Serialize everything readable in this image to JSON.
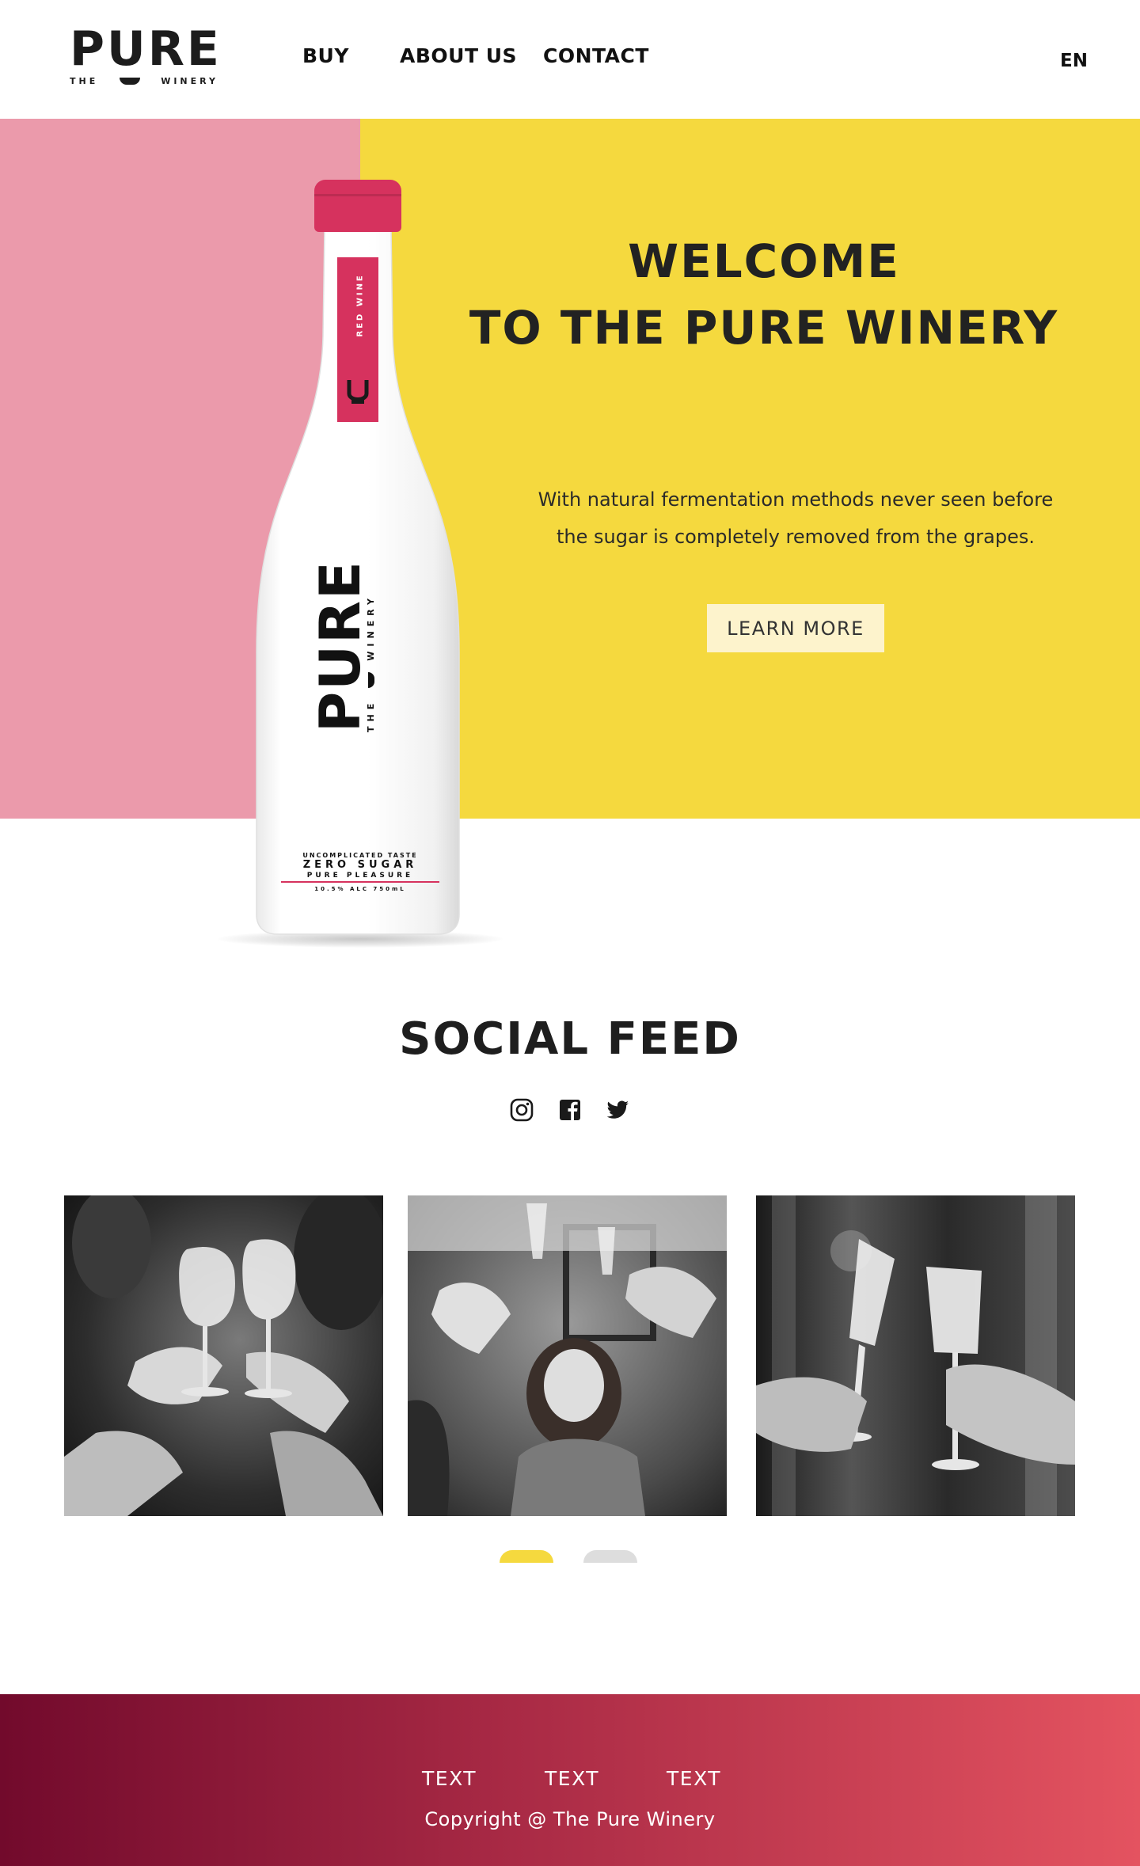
{
  "header": {
    "logo_word": "PURE",
    "logo_sub_left": "THE",
    "logo_sub_right": "WINERY",
    "nav": [
      "BUY",
      "ABOUT US",
      "CONTACT"
    ],
    "language": "EN"
  },
  "hero": {
    "title_line1": "WELCOME",
    "title_line2": "TO THE PURE WINERY",
    "subtitle_line1": "With natural fermentation methods never seen before",
    "subtitle_line2": "the sugar is completely removed from the grapes.",
    "cta_label": "LEARN MORE",
    "colors": {
      "pink": "#eb9aab",
      "yellow": "#f5d93e",
      "cap": "#d6325e"
    }
  },
  "bottle": {
    "neck_label": "RED WINE",
    "brand": "PURE",
    "brand_sub_left": "THE",
    "brand_sub_right": "WINERY",
    "tagline1": "UNCOMPLICATED TASTE",
    "tagline2": "ZERO SUGAR",
    "tagline3": "PURE PLEASURE",
    "specs": "10.5% ALC 750mL"
  },
  "social": {
    "title": "SOCIAL FEED",
    "icons": [
      "instagram-icon",
      "facebook-icon",
      "twitter-icon"
    ],
    "carousel_active_index": 0,
    "carousel_count": 2
  },
  "footer": {
    "links": [
      "TEXT",
      "TEXT",
      "TEXT"
    ],
    "copyright": "Copyright @ The Pure Winery"
  }
}
